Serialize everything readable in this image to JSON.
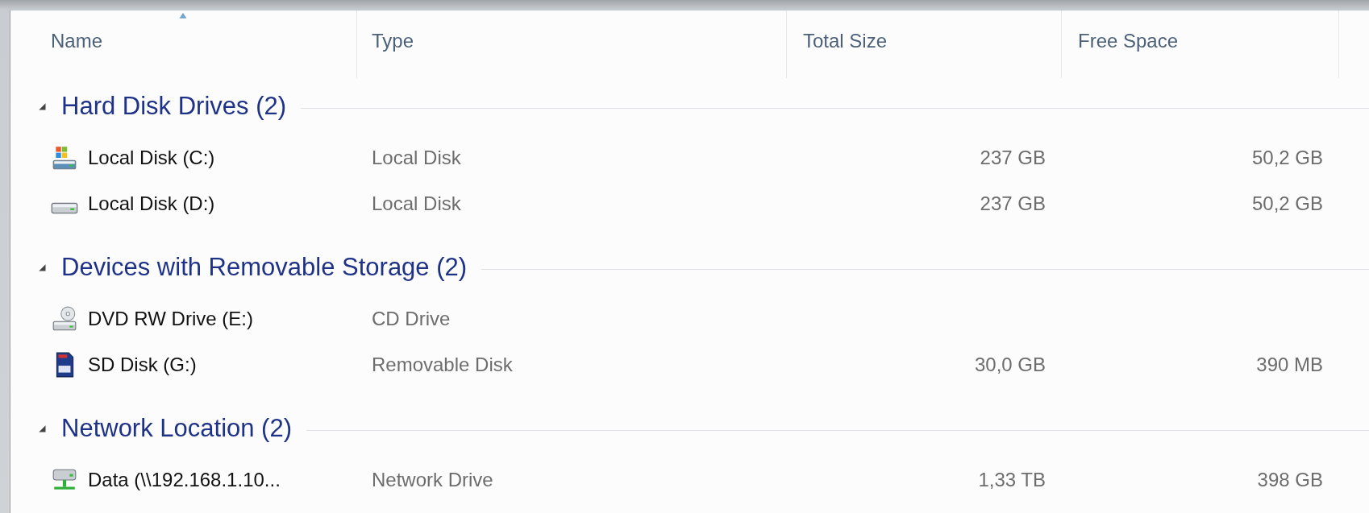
{
  "columns": [
    {
      "label": "Name",
      "sorted": true
    },
    {
      "label": "Type",
      "sorted": false
    },
    {
      "label": "Total Size",
      "sorted": false
    },
    {
      "label": "Free Space",
      "sorted": false
    }
  ],
  "groups": [
    {
      "title": "Hard Disk Drives (2)",
      "expanded": true,
      "items": [
        {
          "kind": "system-disk",
          "name": "Local Disk (C:)",
          "type": "Local Disk",
          "total": "237 GB",
          "free": "50,2 GB"
        },
        {
          "kind": "disk",
          "name": "Local Disk (D:)",
          "type": "Local Disk",
          "total": "237 GB",
          "free": "50,2 GB"
        }
      ]
    },
    {
      "title": "Devices with Removable Storage (2)",
      "expanded": true,
      "items": [
        {
          "kind": "dvd",
          "name": "DVD RW Drive (E:)",
          "type": "CD Drive"
        },
        {
          "kind": "sd",
          "name": "SD Disk (G:)",
          "type": "Removable Disk",
          "total": "30,0 GB",
          "free": "390 MB"
        }
      ]
    },
    {
      "title": "Network Location (2)",
      "expanded": true,
      "items": [
        {
          "kind": "network",
          "name": "Data (\\\\192.168.1.10...",
          "type": "Network Drive",
          "total": "1,33 TB",
          "free": "398 GB"
        }
      ]
    }
  ]
}
